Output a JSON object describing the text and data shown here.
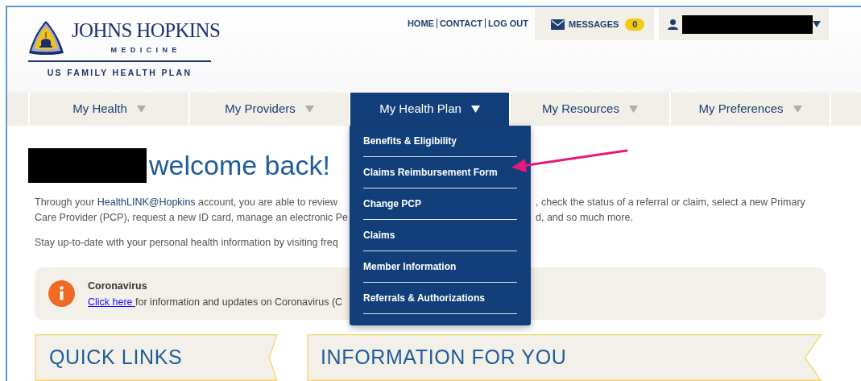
{
  "header": {
    "logo": {
      "title": "JOHNS HOPKINS",
      "subtitle": "MEDICINE",
      "plan": "US FAMILY HEALTH PLAN"
    },
    "top_links": [
      "HOME",
      "CONTACT",
      "LOG OUT"
    ],
    "messages": {
      "label": "MESSAGES",
      "count": "0"
    }
  },
  "nav": [
    {
      "label": "My Health",
      "selected": false
    },
    {
      "label": "My Providers",
      "selected": false
    },
    {
      "label": "My Health Plan",
      "selected": true
    },
    {
      "label": "My Resources",
      "selected": false
    },
    {
      "label": "My Preferences",
      "selected": false
    }
  ],
  "dropdown": [
    "Benefits & Eligibility",
    "Claims Reimbursement Form",
    "Change PCP",
    "Claims",
    "Member Information",
    "Referrals & Authorizations"
  ],
  "welcome": "welcome back!",
  "intro": [
    {
      "left": [
        {
          "kind": "text",
          "text": "Through your "
        },
        {
          "kind": "link",
          "text": "HealthLINK@Hopkins"
        },
        {
          "kind": "text",
          "text": " account, you are able to review"
        }
      ],
      "right": ", check the status of a referral or claim, select a new Primary"
    },
    {
      "left": [
        {
          "kind": "text",
          "text": "Care Provider (PCP), request a new ID card, manage an electronic Pe"
        }
      ],
      "right": "d, and so much more."
    }
  ],
  "reminder": "Stay up-to-date with your personal health information by visiting freq",
  "alert": {
    "title": "Coronavirus",
    "link": "Click here ",
    "text": "for information and updates on Coronavirus (C"
  },
  "banners": [
    "QUICK LINKS",
    "INFORMATION FOR YOU"
  ]
}
